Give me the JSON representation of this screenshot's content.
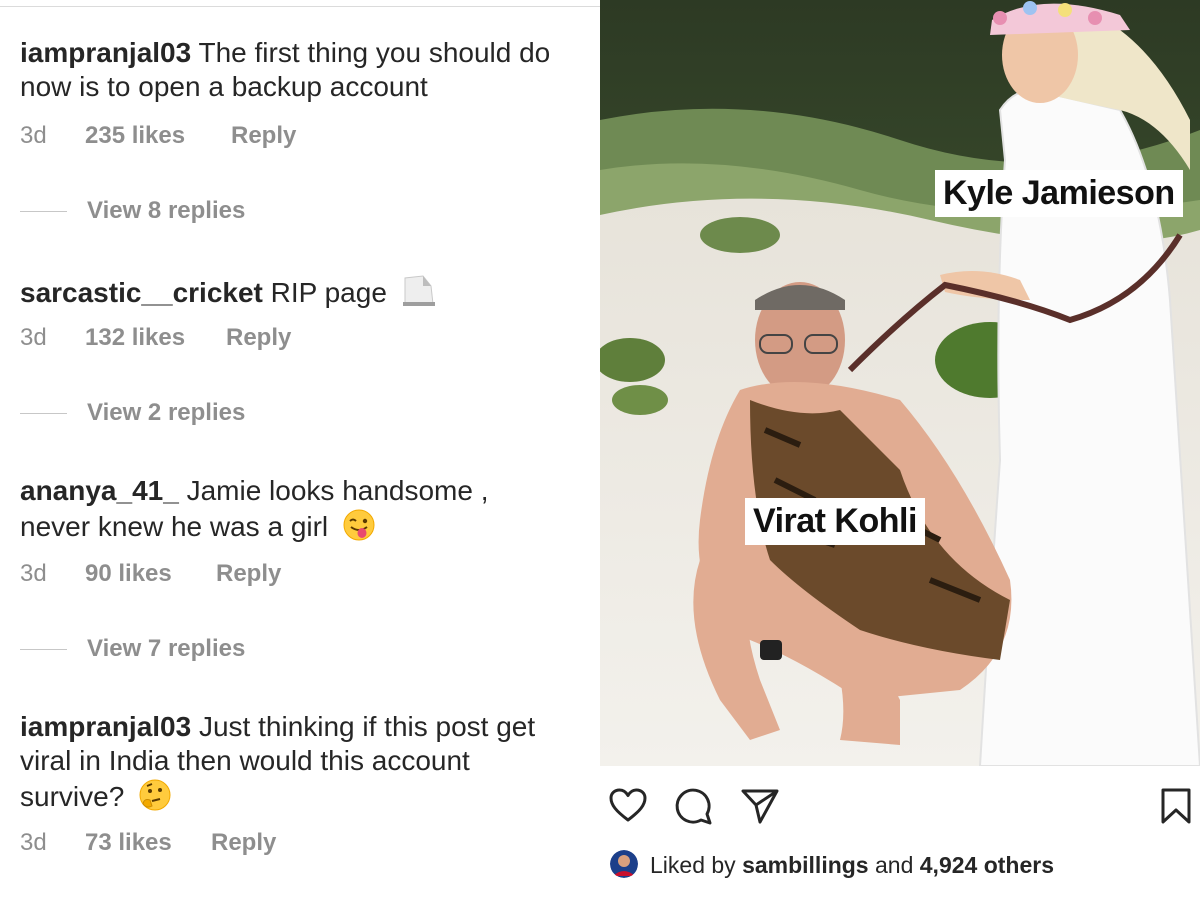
{
  "comments": [
    {
      "username": "iampranjal03",
      "text": "The first thing you should do now is to open a backup account",
      "emoji": "",
      "time": "3d",
      "likes": "235 likes",
      "reply_label": "Reply",
      "view_replies": "View 8 replies"
    },
    {
      "username": "sarcastic__cricket",
      "text": "RIP page",
      "emoji": "headstone",
      "time": "3d",
      "likes": "132 likes",
      "reply_label": "Reply",
      "view_replies": "View 2 replies"
    },
    {
      "username": "ananya_41_",
      "text": "Jamie looks handsome , never knew he was a girl",
      "emoji": "tongue-wink",
      "time": "3d",
      "likes": "90 likes",
      "reply_label": "Reply",
      "view_replies": "View 7 replies"
    },
    {
      "username": "iampranjal03",
      "text": "Just thinking if this post get viral in India then would this account survive?",
      "emoji": "thinking-face",
      "time": "3d",
      "likes": "73 likes",
      "reply_label": "Reply"
    }
  ],
  "post": {
    "labels": {
      "top_right": "Kyle Jamieson",
      "center": "Virat Kohli"
    },
    "actions": {
      "like_icon": "heart-icon",
      "comment_icon": "comment-bubble-icon",
      "share_icon": "paper-plane-icon",
      "save_icon": "bookmark-icon"
    },
    "liked_by": {
      "prefix": "Liked by",
      "user": "sambillings",
      "middle": "and",
      "others": "4,924 others"
    }
  },
  "colors": {
    "text": "#262626",
    "muted": "#8e8e8e",
    "divider": "#dbdbdb"
  }
}
